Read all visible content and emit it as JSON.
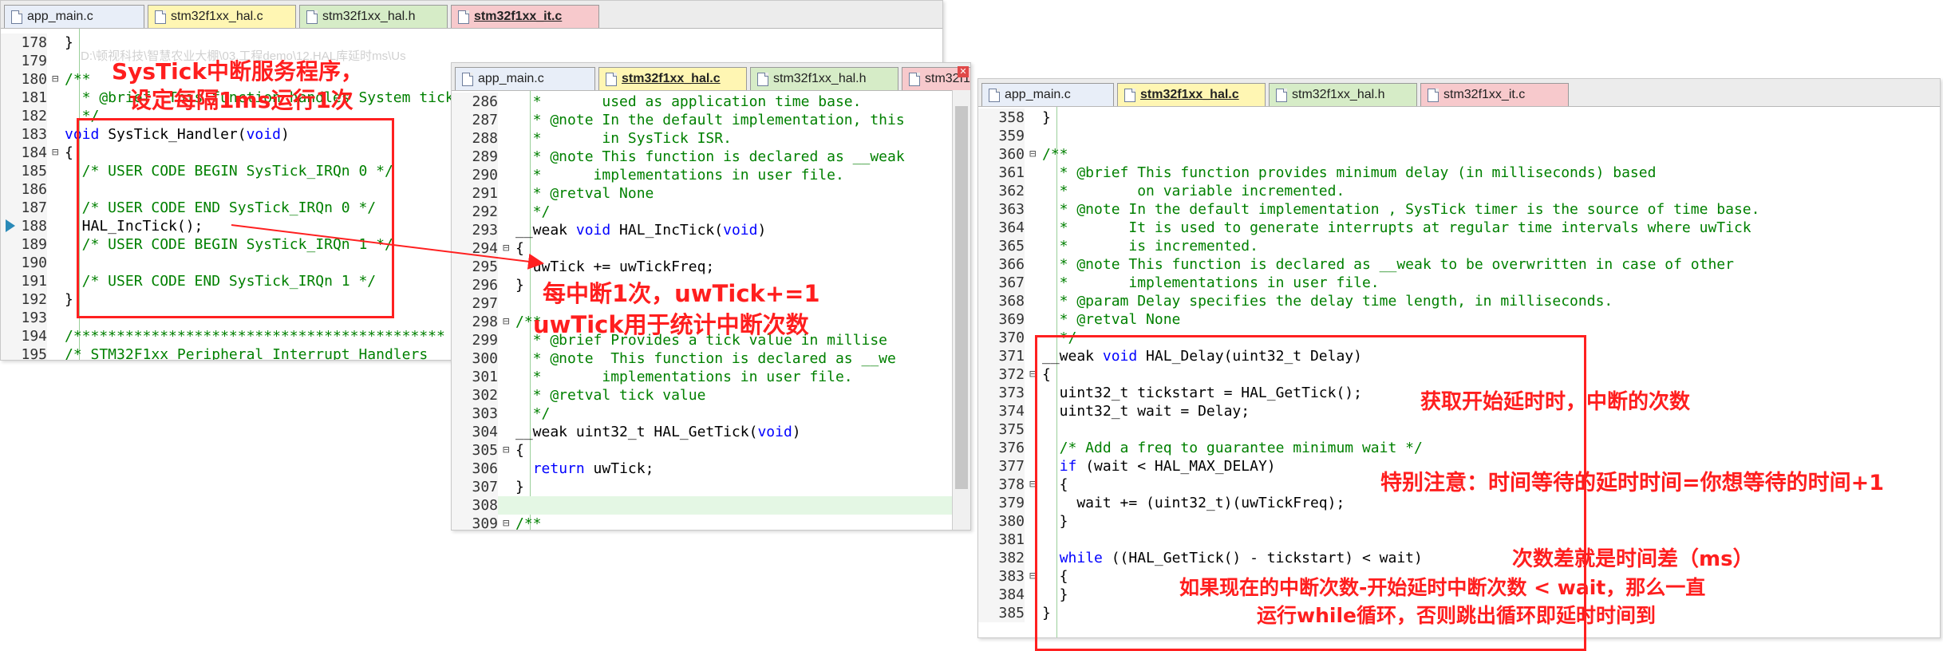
{
  "colors": {
    "accent_red": "#ff2020",
    "keyword": "#0000ff",
    "comment": "#008000",
    "tab_yellow": "#fff6b3",
    "tab_green": "#d6ecc7",
    "tab_pink": "#f7c9cc"
  },
  "panel1": {
    "tabs": [
      {
        "label": "app_main.c",
        "color": "#e8eef8",
        "active": false
      },
      {
        "label": "stm32f1xx_hal.c",
        "color": "#fff6b3",
        "active": false
      },
      {
        "label": "stm32f1xx_hal.h",
        "color": "#d6ecc7",
        "active": false
      },
      {
        "label": "stm32f1xx_it.c",
        "color": "#f7c9cc",
        "active": true
      }
    ],
    "path_faded": "D:\\顿视科技\\智慧农业大棚\\03.工程demo\\12.HAL库延时ms\\Us",
    "lines": [
      {
        "n": "178",
        "g": "",
        "segs": [
          {
            "t": "}",
            "c": ""
          }
        ]
      },
      {
        "n": "179",
        "g": "",
        "segs": [
          {
            "t": "",
            "c": ""
          }
        ]
      },
      {
        "n": "180",
        "g": "⊟",
        "segs": [
          {
            "t": "/**",
            "c": "cm"
          }
        ]
      },
      {
        "n": "181",
        "g": "",
        "segs": [
          {
            "t": "  * @brief  This function handles System tick timer.",
            "c": "cm"
          }
        ]
      },
      {
        "n": "182",
        "g": "",
        "segs": [
          {
            "t": "  */",
            "c": "cm"
          }
        ]
      },
      {
        "n": "183",
        "g": "",
        "segs": [
          {
            "t": "void",
            "c": "kw"
          },
          {
            "t": " SysTick_Handler(",
            "c": ""
          },
          {
            "t": "void",
            "c": "kw"
          },
          {
            "t": ")",
            "c": ""
          }
        ]
      },
      {
        "n": "184",
        "g": "⊟",
        "segs": [
          {
            "t": "{",
            "c": ""
          }
        ]
      },
      {
        "n": "185",
        "g": "",
        "segs": [
          {
            "t": "  /* USER CODE BEGIN SysTick_IRQn 0 */",
            "c": "cm"
          }
        ]
      },
      {
        "n": "186",
        "g": "",
        "segs": [
          {
            "t": "",
            "c": ""
          }
        ]
      },
      {
        "n": "187",
        "g": "",
        "segs": [
          {
            "t": "  /* USER CODE END SysTick_IRQn 0 */",
            "c": "cm"
          }
        ]
      },
      {
        "n": "188",
        "g": "",
        "segs": [
          {
            "t": "  HAL_IncTick();",
            "c": ""
          }
        ]
      },
      {
        "n": "189",
        "g": "",
        "segs": [
          {
            "t": "  /* USER CODE BEGIN SysTick_IRQn 1 */",
            "c": "cm"
          }
        ]
      },
      {
        "n": "190",
        "g": "",
        "segs": [
          {
            "t": "",
            "c": ""
          }
        ]
      },
      {
        "n": "191",
        "g": "",
        "segs": [
          {
            "t": "  /* USER CODE END SysTick_IRQn 1 */",
            "c": "cm"
          }
        ]
      },
      {
        "n": "192",
        "g": "",
        "segs": [
          {
            "t": "}",
            "c": ""
          }
        ]
      },
      {
        "n": "193",
        "g": "",
        "segs": [
          {
            "t": "",
            "c": ""
          }
        ]
      },
      {
        "n": "194",
        "g": "",
        "segs": [
          {
            "t": "/*******************************************",
            "c": "cm"
          }
        ]
      },
      {
        "n": "195",
        "g": "",
        "segs": [
          {
            "t": "/* STM32F1xx Peripheral Interrupt Handlers",
            "c": "cm"
          }
        ]
      }
    ]
  },
  "panel2": {
    "tabs": [
      {
        "label": "app_main.c",
        "color": "#e8eef8",
        "active": false
      },
      {
        "label": "stm32f1xx_hal.c",
        "color": "#fff6b3",
        "active": true
      },
      {
        "label": "stm32f1xx_hal.h",
        "color": "#d6ecc7",
        "active": false
      },
      {
        "label": "stm32f1",
        "color": "#f7c9cc",
        "active": false
      }
    ],
    "lines": [
      {
        "n": "286",
        "g": "",
        "segs": [
          {
            "t": "  *       used as application time base.",
            "c": "cm"
          }
        ]
      },
      {
        "n": "287",
        "g": "",
        "segs": [
          {
            "t": "  * @note In the default implementation, this",
            "c": "cm"
          }
        ]
      },
      {
        "n": "288",
        "g": "",
        "segs": [
          {
            "t": "  *       in SysTick ISR.",
            "c": "cm"
          }
        ]
      },
      {
        "n": "289",
        "g": "",
        "segs": [
          {
            "t": "  * @note This function is declared as __weak",
            "c": "cm"
          }
        ]
      },
      {
        "n": "290",
        "g": "",
        "segs": [
          {
            "t": "  *      implementations in user file.",
            "c": "cm"
          }
        ]
      },
      {
        "n": "291",
        "g": "",
        "segs": [
          {
            "t": "  * @retval None",
            "c": "cm"
          }
        ]
      },
      {
        "n": "292",
        "g": "",
        "segs": [
          {
            "t": "  */",
            "c": "cm"
          }
        ]
      },
      {
        "n": "293",
        "g": "",
        "segs": [
          {
            "t": "__weak ",
            "c": ""
          },
          {
            "t": "void",
            "c": "kw"
          },
          {
            "t": " HAL_IncTick(",
            "c": ""
          },
          {
            "t": "void",
            "c": "kw"
          },
          {
            "t": ")",
            "c": ""
          }
        ]
      },
      {
        "n": "294",
        "g": "⊟",
        "segs": [
          {
            "t": "{",
            "c": ""
          }
        ]
      },
      {
        "n": "295",
        "g": "",
        "segs": [
          {
            "t": "  uwTick += uwTickFreq;",
            "c": ""
          }
        ]
      },
      {
        "n": "296",
        "g": "",
        "segs": [
          {
            "t": "}",
            "c": ""
          }
        ]
      },
      {
        "n": "297",
        "g": "",
        "segs": [
          {
            "t": "",
            "c": ""
          }
        ]
      },
      {
        "n": "298",
        "g": "⊟",
        "segs": [
          {
            "t": "/**",
            "c": "cm"
          }
        ]
      },
      {
        "n": "299",
        "g": "",
        "segs": [
          {
            "t": "  * @brief Provides a tick value in millise",
            "c": "cm"
          }
        ]
      },
      {
        "n": "300",
        "g": "",
        "segs": [
          {
            "t": "  * @note  This function is declared as __we",
            "c": "cm"
          }
        ]
      },
      {
        "n": "301",
        "g": "",
        "segs": [
          {
            "t": "  *       implementations in user file.",
            "c": "cm"
          }
        ]
      },
      {
        "n": "302",
        "g": "",
        "segs": [
          {
            "t": "  * @retval tick value",
            "c": "cm"
          }
        ]
      },
      {
        "n": "303",
        "g": "",
        "segs": [
          {
            "t": "  */",
            "c": "cm"
          }
        ]
      },
      {
        "n": "304",
        "g": "",
        "segs": [
          {
            "t": "__weak uint32_t HAL_GetTick(",
            "c": ""
          },
          {
            "t": "void",
            "c": "kw"
          },
          {
            "t": ")",
            "c": ""
          }
        ]
      },
      {
        "n": "305",
        "g": "⊟",
        "segs": [
          {
            "t": "{",
            "c": ""
          }
        ]
      },
      {
        "n": "306",
        "g": "",
        "segs": [
          {
            "t": "  ",
            "c": ""
          },
          {
            "t": "return",
            "c": "kw"
          },
          {
            "t": " uwTick;",
            "c": ""
          }
        ]
      },
      {
        "n": "307",
        "g": "",
        "segs": [
          {
            "t": "}",
            "c": ""
          }
        ]
      },
      {
        "n": "308",
        "g": "",
        "segs": [
          {
            "t": "",
            "c": ""
          }
        ],
        "hl": true
      },
      {
        "n": "309",
        "g": "⊟",
        "segs": [
          {
            "t": "/**",
            "c": "cm"
          }
        ]
      }
    ]
  },
  "panel3": {
    "tabs": [
      {
        "label": "app_main.c",
        "color": "#e8eef8",
        "active": false
      },
      {
        "label": "stm32f1xx_hal.c",
        "color": "#fff6b3",
        "active": true
      },
      {
        "label": "stm32f1xx_hal.h",
        "color": "#d6ecc7",
        "active": false
      },
      {
        "label": "stm32f1xx_it.c",
        "color": "#f7c9cc",
        "active": false
      }
    ],
    "lines": [
      {
        "n": "358",
        "g": "",
        "segs": [
          {
            "t": "}",
            "c": ""
          }
        ]
      },
      {
        "n": "359",
        "g": "",
        "segs": [
          {
            "t": "",
            "c": ""
          }
        ]
      },
      {
        "n": "360",
        "g": "⊟",
        "segs": [
          {
            "t": "/**",
            "c": "cm"
          }
        ]
      },
      {
        "n": "361",
        "g": "",
        "segs": [
          {
            "t": "  * @brief This function provides minimum delay (in milliseconds) based",
            "c": "cm"
          }
        ]
      },
      {
        "n": "362",
        "g": "",
        "segs": [
          {
            "t": "  *        on variable incremented.",
            "c": "cm"
          }
        ]
      },
      {
        "n": "363",
        "g": "",
        "segs": [
          {
            "t": "  * @note In the default implementation , SysTick timer is the source of time base.",
            "c": "cm"
          }
        ]
      },
      {
        "n": "364",
        "g": "",
        "segs": [
          {
            "t": "  *       It is used to generate interrupts at regular time intervals where uwTick",
            "c": "cm"
          }
        ]
      },
      {
        "n": "365",
        "g": "",
        "segs": [
          {
            "t": "  *       is incremented.",
            "c": "cm"
          }
        ]
      },
      {
        "n": "366",
        "g": "",
        "segs": [
          {
            "t": "  * @note This function is declared as __weak to be overwritten in case of other",
            "c": "cm"
          }
        ]
      },
      {
        "n": "367",
        "g": "",
        "segs": [
          {
            "t": "  *       implementations in user file.",
            "c": "cm"
          }
        ]
      },
      {
        "n": "368",
        "g": "",
        "segs": [
          {
            "t": "  * @param Delay specifies the delay time length, in milliseconds.",
            "c": "cm"
          }
        ]
      },
      {
        "n": "369",
        "g": "",
        "segs": [
          {
            "t": "  * @retval None",
            "c": "cm"
          }
        ]
      },
      {
        "n": "370",
        "g": "",
        "segs": [
          {
            "t": "  */",
            "c": "cm"
          }
        ]
      },
      {
        "n": "371",
        "g": "",
        "segs": [
          {
            "t": "__weak ",
            "c": ""
          },
          {
            "t": "void",
            "c": "kw"
          },
          {
            "t": " HAL_Delay(uint32_t Delay)",
            "c": ""
          }
        ]
      },
      {
        "n": "372",
        "g": "⊟",
        "segs": [
          {
            "t": "{",
            "c": ""
          }
        ]
      },
      {
        "n": "373",
        "g": "",
        "segs": [
          {
            "t": "  uint32_t tickstart = HAL_GetTick();",
            "c": ""
          }
        ]
      },
      {
        "n": "374",
        "g": "",
        "segs": [
          {
            "t": "  uint32_t wait = Delay;",
            "c": ""
          }
        ]
      },
      {
        "n": "375",
        "g": "",
        "segs": [
          {
            "t": "",
            "c": ""
          }
        ]
      },
      {
        "n": "376",
        "g": "",
        "segs": [
          {
            "t": "  /* Add a freq to guarantee minimum wait */",
            "c": "cm"
          }
        ]
      },
      {
        "n": "377",
        "g": "",
        "segs": [
          {
            "t": "  ",
            "c": ""
          },
          {
            "t": "if",
            "c": "kw"
          },
          {
            "t": " (wait < HAL_MAX_DELAY)",
            "c": ""
          }
        ]
      },
      {
        "n": "378",
        "g": "⊟",
        "segs": [
          {
            "t": "  {",
            "c": ""
          }
        ]
      },
      {
        "n": "379",
        "g": "",
        "segs": [
          {
            "t": "    wait += (uint32_t)(uwTickFreq);",
            "c": ""
          }
        ]
      },
      {
        "n": "380",
        "g": "",
        "segs": [
          {
            "t": "  }",
            "c": ""
          }
        ]
      },
      {
        "n": "381",
        "g": "",
        "segs": [
          {
            "t": "",
            "c": ""
          }
        ]
      },
      {
        "n": "382",
        "g": "",
        "segs": [
          {
            "t": "  ",
            "c": ""
          },
          {
            "t": "while",
            "c": "kw"
          },
          {
            "t": " ((HAL_GetTick() - tickstart) < wait)",
            "c": ""
          }
        ]
      },
      {
        "n": "383",
        "g": "⊟",
        "segs": [
          {
            "t": "  {",
            "c": ""
          }
        ]
      },
      {
        "n": "384",
        "g": "",
        "segs": [
          {
            "t": "  }",
            "c": ""
          }
        ]
      },
      {
        "n": "385",
        "g": "",
        "segs": [
          {
            "t": "}",
            "c": ""
          }
        ]
      }
    ]
  },
  "annotations": {
    "systick_title_1": "SysTick中断服务程序，",
    "systick_title_2": "设定每隔1ms运行1次",
    "each_irq": "每中断1次，uwTick+=1",
    "uwtick_purpose": "uwTick用于统计中断次数",
    "get_start": "获取开始延时时，中断的次数",
    "special_note": "特别注意：时间等待的延时时间=你想等待的时间+1",
    "count_diff": "次数差就是时间差（ms）",
    "loop_desc_1": "如果现在的中断次数-开始延时中断次数 < wait，那么一直",
    "loop_desc_2": "运行while循环，否则跳出循环即延时时间到"
  }
}
